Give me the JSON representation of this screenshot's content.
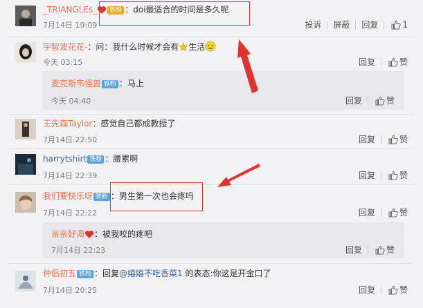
{
  "labels": {
    "report": "投诉",
    "block": "屏蔽",
    "reply": "回复",
    "like": "赞",
    "iron_fan": "铁粉"
  },
  "colors": {
    "username": "#eb7350",
    "link": "#3b6aa8",
    "badge_blue": "#5aa2e8",
    "badge_gold": "#f0a81c",
    "highlight": "#e3312d"
  },
  "comments": [
    {
      "user": "_TRIANGLEs_",
      "badge": "铁粉",
      "text": "：doi最适合的时间是多久呢",
      "time": "7月14日 19:09",
      "likes": "1"
    },
    {
      "user": "宇智波花花-",
      "text_before": "：问：我什么时候才会有",
      "text_after": "生活",
      "time": "今天 03:15",
      "replies": [
        {
          "user": "麦克斯韦怪兽",
          "badge": "铁粉",
          "text": "：马上",
          "time": "今天 04:40"
        }
      ]
    },
    {
      "user": "王先森Taylor",
      "text": "：感觉自己都成教授了",
      "time": "7月14日 22:50"
    },
    {
      "user": "harrytshirt",
      "badge": "铁粉",
      "text": "：腰累啊",
      "time": "7月14日 22:39"
    },
    {
      "user": "我们要快乐呀",
      "badge": "铁粉",
      "text": "：男生第一次也会疼吗",
      "time": "7月14日 22:22",
      "replies": [
        {
          "user": "亲亲好渴",
          "text": "：被我咬的疼吧",
          "time": "7月14日 22:23"
        }
      ]
    },
    {
      "user": "仲侣初五",
      "badge": "铁粉",
      "text_prefix": "：回复",
      "mention": "@嬉嬉不吃香菜1",
      "text_suffix": " 的表态:你这是开金口了",
      "time": "7月14日 20:25"
    }
  ]
}
